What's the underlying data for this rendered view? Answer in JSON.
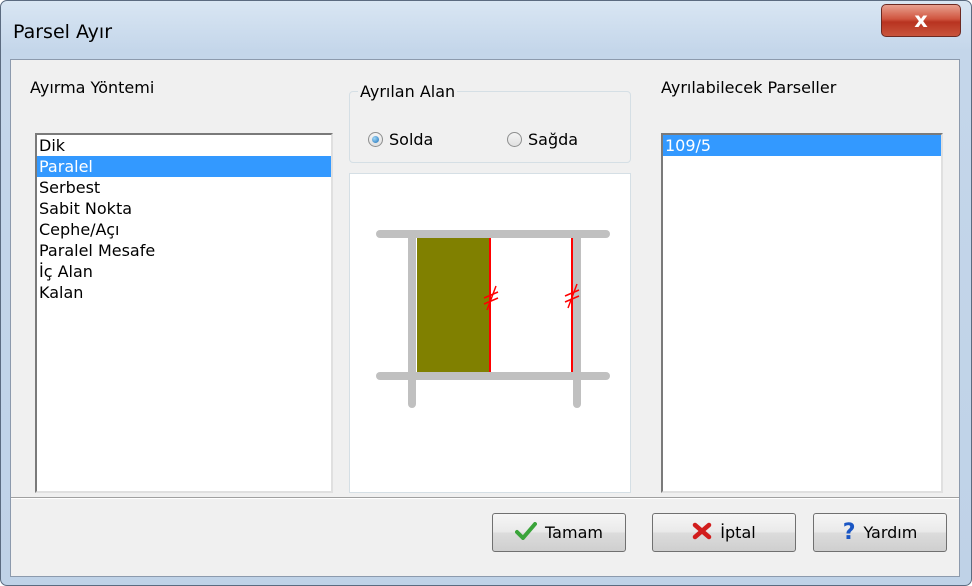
{
  "window": {
    "title": "Parsel Ayır",
    "close_glyph": "x"
  },
  "method": {
    "label": "Ayırma Yöntemi",
    "items": [
      "Dik",
      "Paralel",
      "Serbest",
      "Sabit Nokta",
      "Cephe/Açı",
      "Paralel Mesafe",
      "İç Alan",
      "Kalan"
    ],
    "selected": "Paralel"
  },
  "area": {
    "label": "Ayrılan Alan",
    "options": [
      "Solda",
      "Sağda"
    ],
    "selected": "Solda"
  },
  "parcels": {
    "label": "Ayrılabilecek Parseller",
    "items": [
      "109/5"
    ],
    "selected": "109/5"
  },
  "buttons": {
    "ok": "Tamam",
    "cancel": "İptal",
    "help": "Yardım"
  },
  "icons": {
    "ok": "checkmark-icon",
    "cancel": "red-x-icon",
    "help": "question-mark-icon"
  },
  "colors": {
    "selection": "#3399ff",
    "parcel_fill": "#808000",
    "split_line": "#ff0000",
    "road": "#c0c0c0"
  }
}
